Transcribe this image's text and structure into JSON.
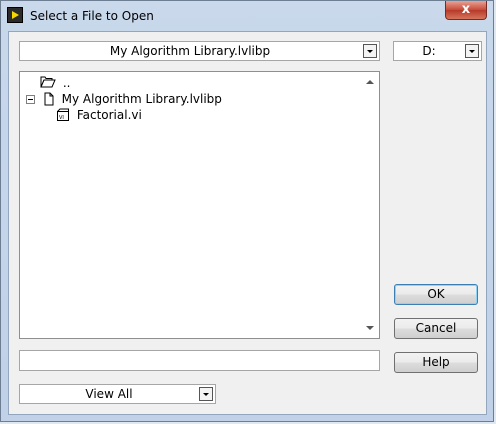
{
  "window": {
    "title": "Select a File to Open",
    "close_symbol": "x"
  },
  "location": {
    "selected": "My Algorithm Library.lvlibp"
  },
  "drive": {
    "selected": "D:"
  },
  "tree": {
    "items": [
      {
        "label": "..",
        "icon": "folder-open-icon"
      },
      {
        "label": "My Algorithm Library.lvlibp",
        "icon": "document-icon",
        "expander": "collapse-toggle-icon"
      },
      {
        "label": "Factorial.vi",
        "icon": "vi-file-icon"
      }
    ]
  },
  "filename": {
    "value": ""
  },
  "filter": {
    "selected": "View All"
  },
  "buttons": {
    "ok": "OK",
    "cancel": "Cancel",
    "help": "Help"
  }
}
